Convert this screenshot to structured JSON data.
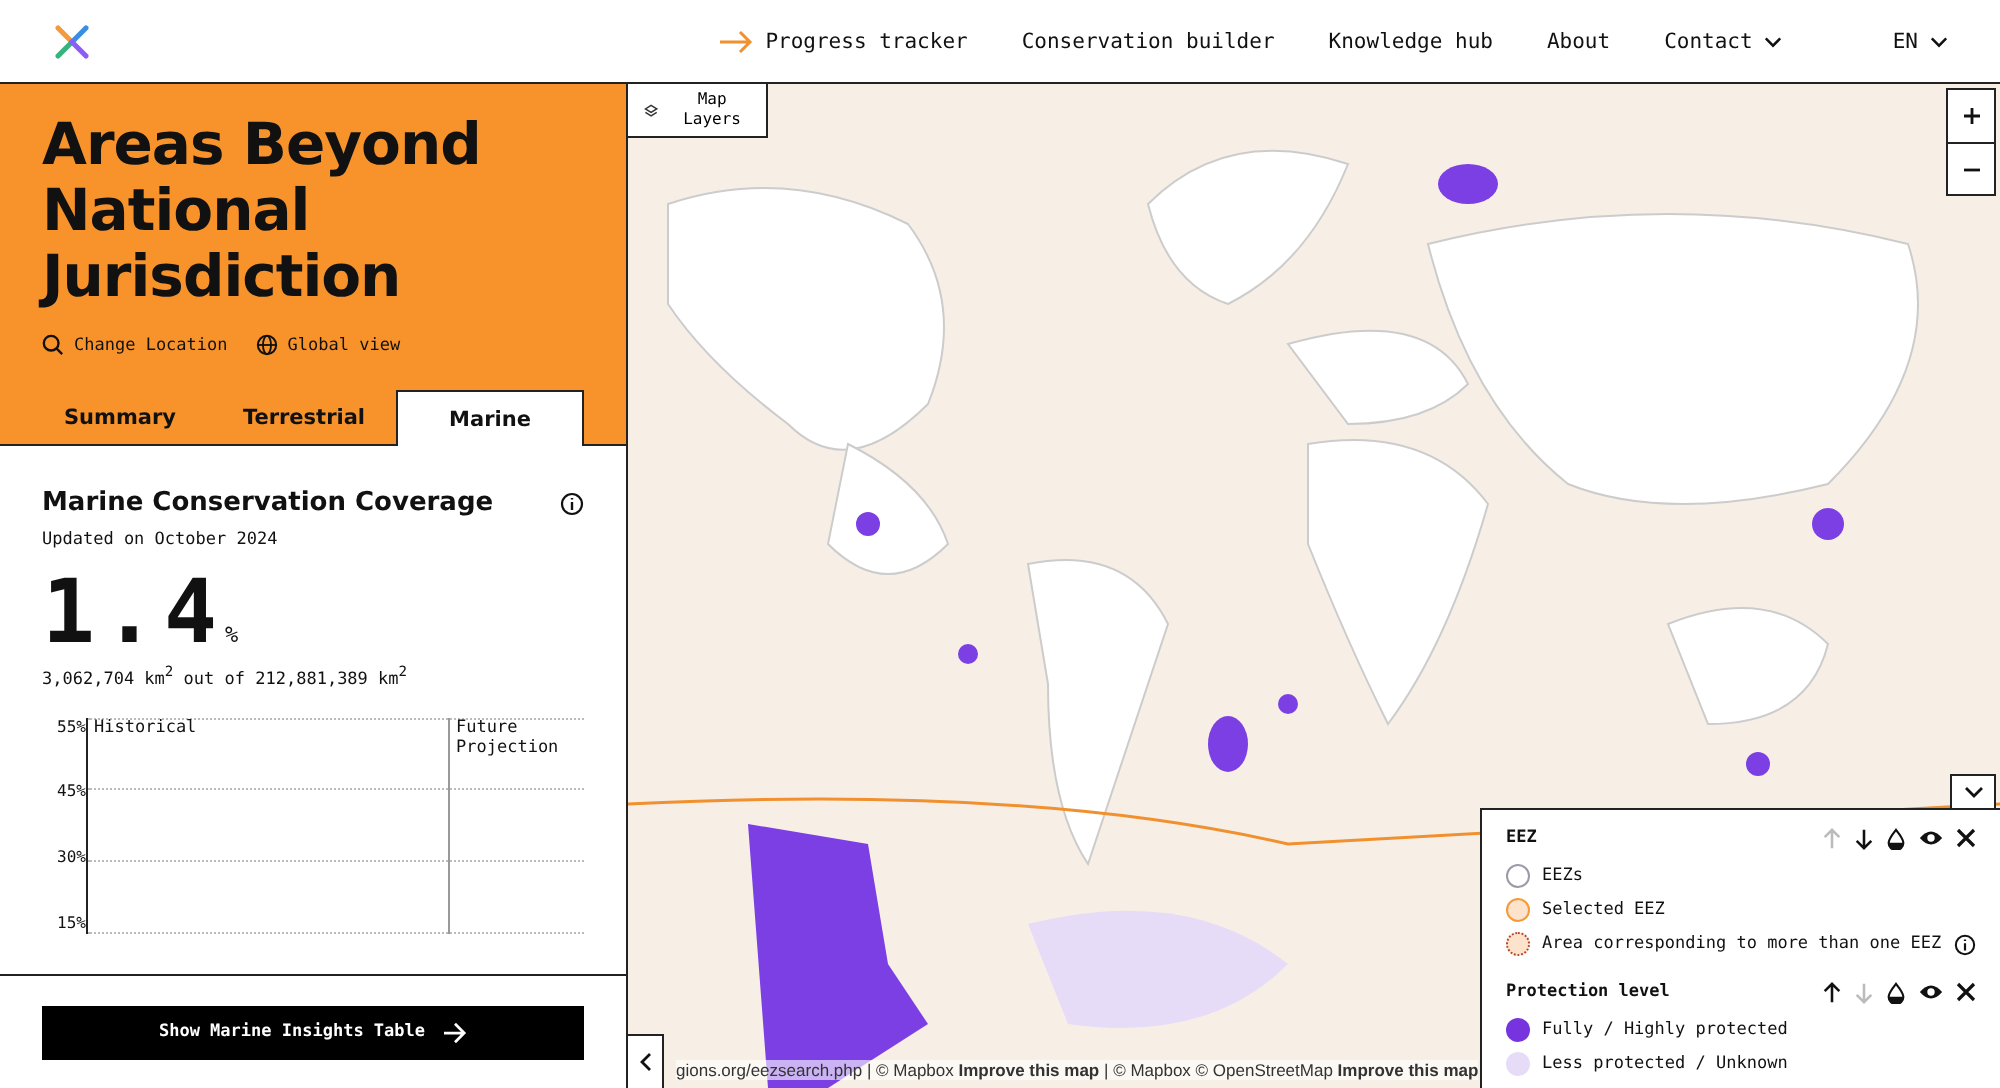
{
  "nav": {
    "items": [
      {
        "label": "Progress tracker",
        "selected": true,
        "dropdown": false
      },
      {
        "label": "Conservation builder",
        "selected": false,
        "dropdown": false
      },
      {
        "label": "Knowledge hub",
        "selected": false,
        "dropdown": false
      },
      {
        "label": "About",
        "selected": false,
        "dropdown": false
      },
      {
        "label": "Contact",
        "selected": false,
        "dropdown": true
      },
      {
        "label": "EN",
        "selected": false,
        "dropdown": true
      }
    ]
  },
  "location": {
    "title": "Areas Beyond National Jurisdiction",
    "actions": [
      {
        "kind": "search",
        "label": "Change Location"
      },
      {
        "kind": "globe",
        "label": "Global view"
      }
    ]
  },
  "tabs": [
    {
      "label": "Summary",
      "selected": false
    },
    {
      "label": "Terrestrial",
      "selected": false
    },
    {
      "label": "Marine",
      "selected": true
    }
  ],
  "coverage": {
    "title": "Marine Conservation Coverage",
    "updated": "Updated on October 2024",
    "value": "1.4",
    "unit": "%",
    "area": "3,062,704 km$^{2}$ out of 212,881,389 km$^{2}$"
  },
  "chart": {
    "y_ticks": [
      "55%",
      "45%",
      "30%",
      "15%"
    ],
    "periods": [
      "Historical",
      "Future Projection"
    ]
  },
  "insights_button": "Show Marine Insights Table",
  "map": {
    "layers_button": "Map Layers",
    "attribution": "gions.org/eezsearch.php | © Mapbox **Improve this map** | © Mapbox © OpenStreetMap **Improve this map**"
  },
  "legend": {
    "groups": [
      {
        "title": "EEZ",
        "up_disabled": true,
        "down_disabled": false,
        "items": [
          {
            "label": "EEZs",
            "kind": "outline",
            "color": "#9a9aa8",
            "info": false
          },
          {
            "label": "Selected EEZ",
            "kind": "filled-outline",
            "color": "#f59a3c",
            "info": false
          },
          {
            "label": "Area corresponding to more than one EEZ",
            "kind": "dotted",
            "color": "#b5452a",
            "info": true
          }
        ]
      },
      {
        "title": "Protection level",
        "up_disabled": false,
        "down_disabled": true,
        "items": [
          {
            "label": "Fully / Highly protected",
            "kind": "solid",
            "color": "#7733dd",
            "info": false
          },
          {
            "label": "Less protected / Unknown",
            "kind": "solid",
            "color": "#e6dcf8",
            "info": false
          }
        ]
      }
    ]
  }
}
